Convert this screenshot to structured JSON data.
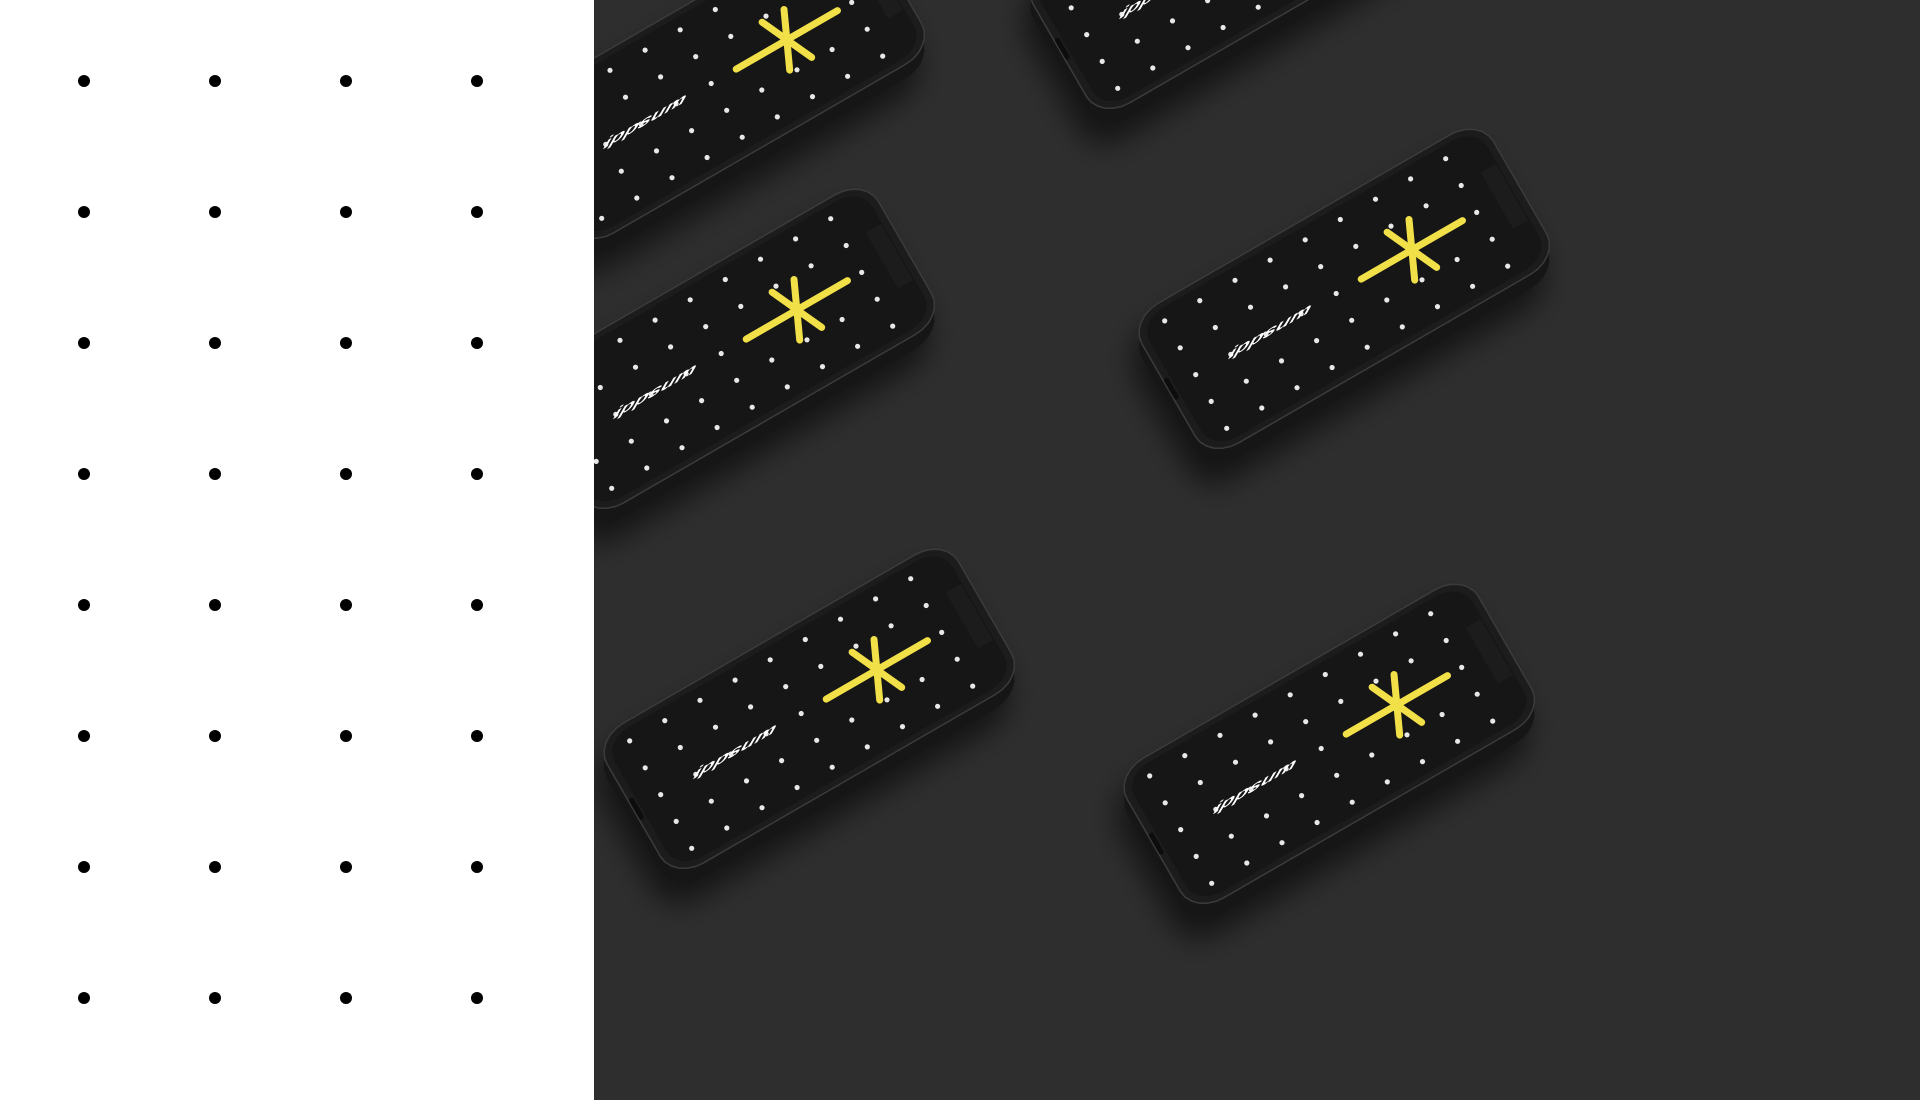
{
  "brand": {
    "wordmark": "ippsum",
    "accent_color": "#f2e04a",
    "screen_color": "#141414",
    "frame_color": "#1f1f1f",
    "backdrop_color": "#2e2e2e",
    "panel_color": "#ffffff",
    "dot_color": "#000000"
  },
  "dot_pattern": {
    "columns": 4,
    "rows": 8
  },
  "phones": [
    {
      "id": "phone-top-left",
      "wordmark": "ippsum",
      "shows_asterisk": true
    },
    {
      "id": "phone-top-right",
      "wordmark": "ippsum",
      "shows_asterisk": false
    },
    {
      "id": "phone-middle-left",
      "wordmark": "ippsum",
      "shows_asterisk": true
    },
    {
      "id": "phone-middle-right",
      "wordmark": "ippsum",
      "shows_asterisk": true
    },
    {
      "id": "phone-bottom-left",
      "wordmark": "ippsum",
      "shows_asterisk": true
    },
    {
      "id": "phone-bottom-right",
      "wordmark": "ippsum",
      "shows_asterisk": true
    }
  ]
}
